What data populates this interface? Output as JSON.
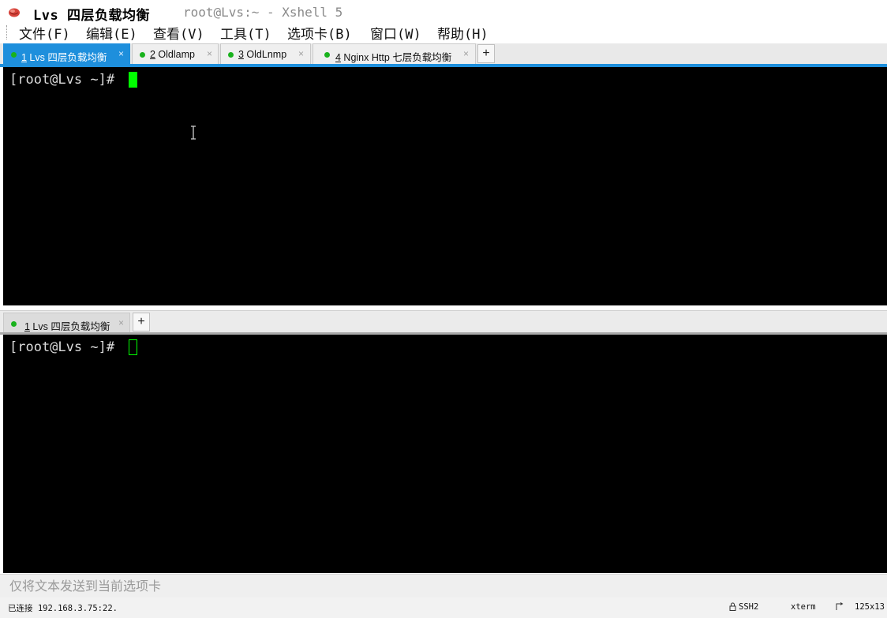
{
  "window": {
    "title_main": "Lvs 四层负载均衡",
    "title_sub": "root@Lvs:~ - Xshell 5"
  },
  "menu": [
    "文件(F)",
    "编辑(E)",
    "查看(V)",
    "工具(T)",
    "选项卡(B)",
    "窗口(W)",
    "帮助(H)"
  ],
  "top_tabs": [
    {
      "num": "1",
      "label": " Lvs 四层负载均衡",
      "active": true
    },
    {
      "num": "2",
      "label": " Oldlamp",
      "active": false
    },
    {
      "num": "3",
      "label": " OldLnmp",
      "active": false
    },
    {
      "num": "4",
      "label": " Nginx Http 七层负载均衡",
      "active": false
    }
  ],
  "bottom_tabs": [
    {
      "num": "1",
      "label": " Lvs 四层负载均衡",
      "active": false
    }
  ],
  "add_tab_symbol": "+",
  "close_symbol": "×",
  "terminal_top": {
    "prompt": "[root@Lvs ~]# "
  },
  "terminal_bottom": {
    "prompt": "[root@Lvs ~]# "
  },
  "sendbar": {
    "placeholder": "仅将文本发送到当前选项卡"
  },
  "status": {
    "connection": "已连接 192.168.3.75:22.",
    "protocol": "SSH2",
    "terminal_type": "xterm",
    "size": "125x13"
  },
  "colors": {
    "accent": "#1e8fdc",
    "tab_dot": "#19b21d",
    "cursor": "#00ff00",
    "terminal_bg": "#000000"
  }
}
